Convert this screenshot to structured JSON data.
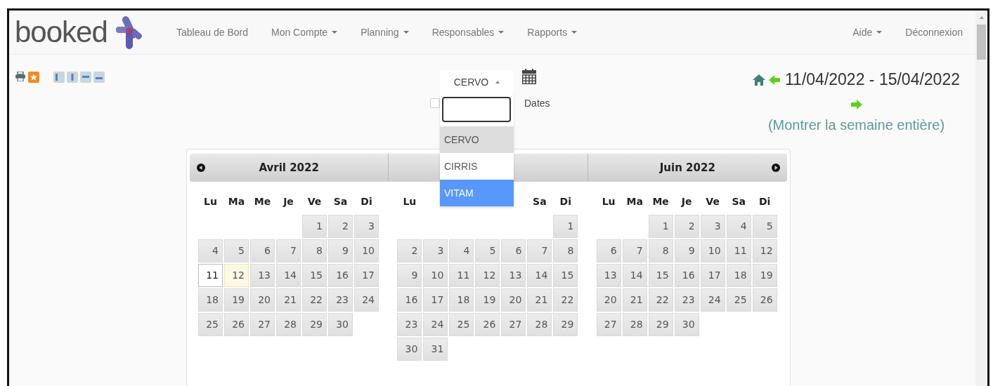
{
  "logo": {
    "text": "booked"
  },
  "nav": {
    "left": [
      {
        "label": "Tableau de Bord",
        "dropdown": false
      },
      {
        "label": "Mon Compte",
        "dropdown": true
      },
      {
        "label": "Planning",
        "dropdown": true
      },
      {
        "label": "Responsables",
        "dropdown": true
      },
      {
        "label": "Rapports",
        "dropdown": true
      }
    ],
    "right": [
      {
        "label": "Aide",
        "dropdown": true
      },
      {
        "label": "Déconnexion",
        "dropdown": false
      }
    ]
  },
  "resource_select": {
    "value": "CERVO",
    "open": true,
    "options": [
      {
        "label": "CERVO",
        "selected": true,
        "hovered": false
      },
      {
        "label": "CIRRIS",
        "selected": false,
        "hovered": false
      },
      {
        "label": "VITAM",
        "selected": false,
        "hovered": true
      }
    ]
  },
  "dates_checkbox": {
    "label": "Dates",
    "checked": false
  },
  "date_range": {
    "text": "11/04/2022 - 15/04/2022",
    "link": "(Montrer la semaine entière)"
  },
  "months": [
    {
      "title": "Avril 2022",
      "weekdays": [
        {
          "kind": "label",
          "label": "Lu"
        },
        {
          "kind": "label",
          "label": "Ma"
        },
        {
          "kind": "label",
          "label": "Me"
        },
        {
          "kind": "label",
          "label": "Je"
        },
        {
          "kind": "label",
          "label": "Ve"
        },
        {
          "kind": "label",
          "label": "Sa"
        },
        {
          "kind": "label",
          "label": "Di"
        }
      ],
      "days": [
        {
          "kind": "blank"
        },
        {
          "kind": "blank"
        },
        {
          "kind": "blank"
        },
        {
          "kind": "blank"
        },
        {
          "kind": "day",
          "label": "1",
          "selected": false,
          "today": false
        },
        {
          "kind": "day",
          "label": "2",
          "selected": false,
          "today": false
        },
        {
          "kind": "day",
          "label": "3",
          "selected": false,
          "today": false
        },
        {
          "kind": "day",
          "label": "4",
          "selected": false,
          "today": false
        },
        {
          "kind": "day",
          "label": "5",
          "selected": false,
          "today": false
        },
        {
          "kind": "day",
          "label": "6",
          "selected": false,
          "today": false
        },
        {
          "kind": "day",
          "label": "7",
          "selected": false,
          "today": false
        },
        {
          "kind": "day",
          "label": "8",
          "selected": false,
          "today": false
        },
        {
          "kind": "day",
          "label": "9",
          "selected": false,
          "today": false
        },
        {
          "kind": "day",
          "label": "10",
          "selected": false,
          "today": false
        },
        {
          "kind": "day",
          "label": "11",
          "selected": true,
          "today": false
        },
        {
          "kind": "day",
          "label": "12",
          "selected": false,
          "today": true
        },
        {
          "kind": "day",
          "label": "13",
          "selected": false,
          "today": false
        },
        {
          "kind": "day",
          "label": "14",
          "selected": false,
          "today": false
        },
        {
          "kind": "day",
          "label": "15",
          "selected": false,
          "today": false
        },
        {
          "kind": "day",
          "label": "16",
          "selected": false,
          "today": false
        },
        {
          "kind": "day",
          "label": "17",
          "selected": false,
          "today": false
        },
        {
          "kind": "day",
          "label": "18",
          "selected": false,
          "today": false
        },
        {
          "kind": "day",
          "label": "19",
          "selected": false,
          "today": false
        },
        {
          "kind": "day",
          "label": "20",
          "selected": false,
          "today": false
        },
        {
          "kind": "day",
          "label": "21",
          "selected": false,
          "today": false
        },
        {
          "kind": "day",
          "label": "22",
          "selected": false,
          "today": false
        },
        {
          "kind": "day",
          "label": "23",
          "selected": false,
          "today": false
        },
        {
          "kind": "day",
          "label": "24",
          "selected": false,
          "today": false
        },
        {
          "kind": "day",
          "label": "25",
          "selected": false,
          "today": false
        },
        {
          "kind": "day",
          "label": "26",
          "selected": false,
          "today": false
        },
        {
          "kind": "day",
          "label": "27",
          "selected": false,
          "today": false
        },
        {
          "kind": "day",
          "label": "28",
          "selected": false,
          "today": false
        },
        {
          "kind": "day",
          "label": "29",
          "selected": false,
          "today": false
        },
        {
          "kind": "day",
          "label": "30",
          "selected": false,
          "today": false
        }
      ]
    },
    {
      "weekdays": [
        {
          "kind": "label",
          "label": "Lu"
        },
        {
          "kind": "covered"
        },
        {
          "kind": "covered"
        },
        {
          "kind": "covered"
        },
        {
          "kind": "covered"
        },
        {
          "kind": "label",
          "label": "Sa"
        },
        {
          "kind": "label",
          "label": "Di"
        }
      ],
      "days": [
        {
          "kind": "blank"
        },
        {
          "kind": "blank"
        },
        {
          "kind": "blank"
        },
        {
          "kind": "blank"
        },
        {
          "kind": "blank"
        },
        {
          "kind": "blank"
        },
        {
          "kind": "day",
          "label": "1",
          "selected": false,
          "today": false
        },
        {
          "kind": "day",
          "label": "2",
          "selected": false,
          "today": false
        },
        {
          "kind": "day",
          "label": "3",
          "selected": false,
          "today": false
        },
        {
          "kind": "day",
          "label": "4",
          "selected": false,
          "today": false
        },
        {
          "kind": "day",
          "label": "5",
          "selected": false,
          "today": false
        },
        {
          "kind": "day",
          "label": "6",
          "selected": false,
          "today": false
        },
        {
          "kind": "day",
          "label": "7",
          "selected": false,
          "today": false
        },
        {
          "kind": "day",
          "label": "8",
          "selected": false,
          "today": false
        },
        {
          "kind": "day",
          "label": "9",
          "selected": false,
          "today": false
        },
        {
          "kind": "day",
          "label": "10",
          "selected": false,
          "today": false
        },
        {
          "kind": "day",
          "label": "11",
          "selected": false,
          "today": false
        },
        {
          "kind": "day",
          "label": "12",
          "selected": false,
          "today": false
        },
        {
          "kind": "day",
          "label": "13",
          "selected": false,
          "today": false
        },
        {
          "kind": "day",
          "label": "14",
          "selected": false,
          "today": false
        },
        {
          "kind": "day",
          "label": "15",
          "selected": false,
          "today": false
        },
        {
          "kind": "day",
          "label": "16",
          "selected": false,
          "today": false
        },
        {
          "kind": "day",
          "label": "17",
          "selected": false,
          "today": false
        },
        {
          "kind": "day",
          "label": "18",
          "selected": false,
          "today": false
        },
        {
          "kind": "day",
          "label": "19",
          "selected": false,
          "today": false
        },
        {
          "kind": "day",
          "label": "20",
          "selected": false,
          "today": false
        },
        {
          "kind": "day",
          "label": "21",
          "selected": false,
          "today": false
        },
        {
          "kind": "day",
          "label": "22",
          "selected": false,
          "today": false
        },
        {
          "kind": "day",
          "label": "23",
          "selected": false,
          "today": false
        },
        {
          "kind": "day",
          "label": "24",
          "selected": false,
          "today": false
        },
        {
          "kind": "day",
          "label": "25",
          "selected": false,
          "today": false
        },
        {
          "kind": "day",
          "label": "26",
          "selected": false,
          "today": false
        },
        {
          "kind": "day",
          "label": "27",
          "selected": false,
          "today": false
        },
        {
          "kind": "day",
          "label": "28",
          "selected": false,
          "today": false
        },
        {
          "kind": "day",
          "label": "29",
          "selected": false,
          "today": false
        },
        {
          "kind": "day",
          "label": "30",
          "selected": false,
          "today": false
        },
        {
          "kind": "day",
          "label": "31",
          "selected": false,
          "today": false
        }
      ]
    },
    {
      "title": "Juin 2022",
      "weekdays": [
        {
          "kind": "label",
          "label": "Lu"
        },
        {
          "kind": "label",
          "label": "Ma"
        },
        {
          "kind": "label",
          "label": "Me"
        },
        {
          "kind": "label",
          "label": "Je"
        },
        {
          "kind": "label",
          "label": "Ve"
        },
        {
          "kind": "label",
          "label": "Sa"
        },
        {
          "kind": "label",
          "label": "Di"
        }
      ],
      "days": [
        {
          "kind": "blank"
        },
        {
          "kind": "blank"
        },
        {
          "kind": "day",
          "label": "1",
          "selected": false,
          "today": false
        },
        {
          "kind": "day",
          "label": "2",
          "selected": false,
          "today": false
        },
        {
          "kind": "day",
          "label": "3",
          "selected": false,
          "today": false
        },
        {
          "kind": "day",
          "label": "4",
          "selected": false,
          "today": false
        },
        {
          "kind": "day",
          "label": "5",
          "selected": false,
          "today": false
        },
        {
          "kind": "day",
          "label": "6",
          "selected": false,
          "today": false
        },
        {
          "kind": "day",
          "label": "7",
          "selected": false,
          "today": false
        },
        {
          "kind": "day",
          "label": "8",
          "selected": false,
          "today": false
        },
        {
          "kind": "day",
          "label": "9",
          "selected": false,
          "today": false
        },
        {
          "kind": "day",
          "label": "10",
          "selected": false,
          "today": false
        },
        {
          "kind": "day",
          "label": "11",
          "selected": false,
          "today": false
        },
        {
          "kind": "day",
          "label": "12",
          "selected": false,
          "today": false
        },
        {
          "kind": "day",
          "label": "13",
          "selected": false,
          "today": false
        },
        {
          "kind": "day",
          "label": "14",
          "selected": false,
          "today": false
        },
        {
          "kind": "day",
          "label": "15",
          "selected": false,
          "today": false
        },
        {
          "kind": "day",
          "label": "16",
          "selected": false,
          "today": false
        },
        {
          "kind": "day",
          "label": "17",
          "selected": false,
          "today": false
        },
        {
          "kind": "day",
          "label": "18",
          "selected": false,
          "today": false
        },
        {
          "kind": "day",
          "label": "19",
          "selected": false,
          "today": false
        },
        {
          "kind": "day",
          "label": "20",
          "selected": false,
          "today": false
        },
        {
          "kind": "day",
          "label": "21",
          "selected": false,
          "today": false
        },
        {
          "kind": "day",
          "label": "22",
          "selected": false,
          "today": false
        },
        {
          "kind": "day",
          "label": "23",
          "selected": false,
          "today": false
        },
        {
          "kind": "day",
          "label": "24",
          "selected": false,
          "today": false
        },
        {
          "kind": "day",
          "label": "25",
          "selected": false,
          "today": false
        },
        {
          "kind": "day",
          "label": "26",
          "selected": false,
          "today": false
        },
        {
          "kind": "day",
          "label": "27",
          "selected": false,
          "today": false
        },
        {
          "kind": "day",
          "label": "28",
          "selected": false,
          "today": false
        },
        {
          "kind": "day",
          "label": "29",
          "selected": false,
          "today": false
        },
        {
          "kind": "day",
          "label": "30",
          "selected": false,
          "today": false
        }
      ]
    }
  ]
}
